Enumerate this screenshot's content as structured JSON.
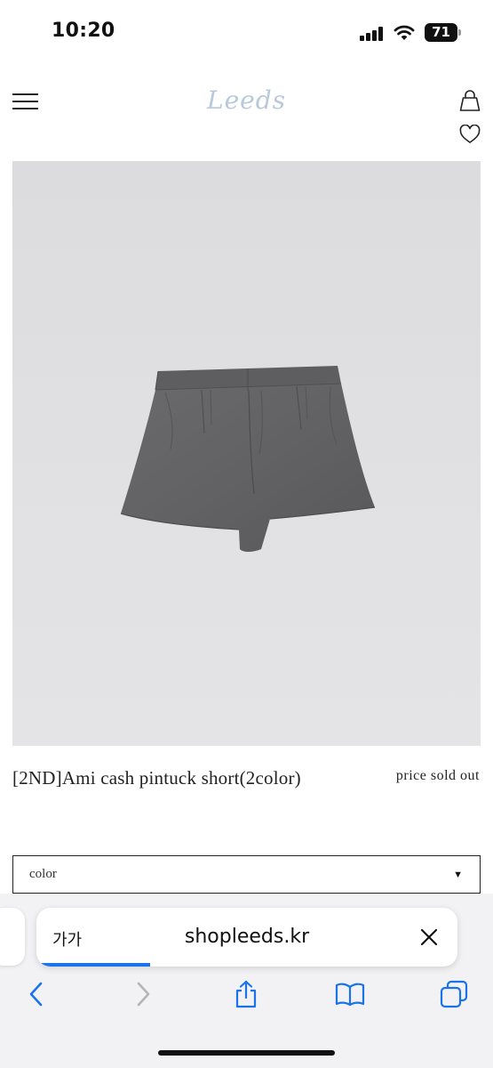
{
  "status_bar": {
    "time": "10:20",
    "battery": "71"
  },
  "site": {
    "logo": "Leeds",
    "menu_icon": "hamburger-menu-icon",
    "cart_icon": "shopping-bag-icon",
    "wishlist_icon": "heart-icon"
  },
  "product": {
    "image_alt": "grey pintuck shorts product photo",
    "name": "[2ND]Ami cash pintuck short(2color)",
    "price": "price sold out"
  },
  "options": {
    "color_select": {
      "selected": "color",
      "arrow": "▼"
    }
  },
  "browser": {
    "font_size_button": "가가",
    "url": "shopleeds.kr",
    "load_progress": 0.27,
    "toolbar": {
      "back_icon": "chevron-left-icon",
      "forward_icon": "chevron-right-icon",
      "share_icon": "share-icon",
      "bookmarks_icon": "book-icon",
      "tabs_icon": "tabs-icon"
    },
    "accent_color": "#1a73e8"
  }
}
